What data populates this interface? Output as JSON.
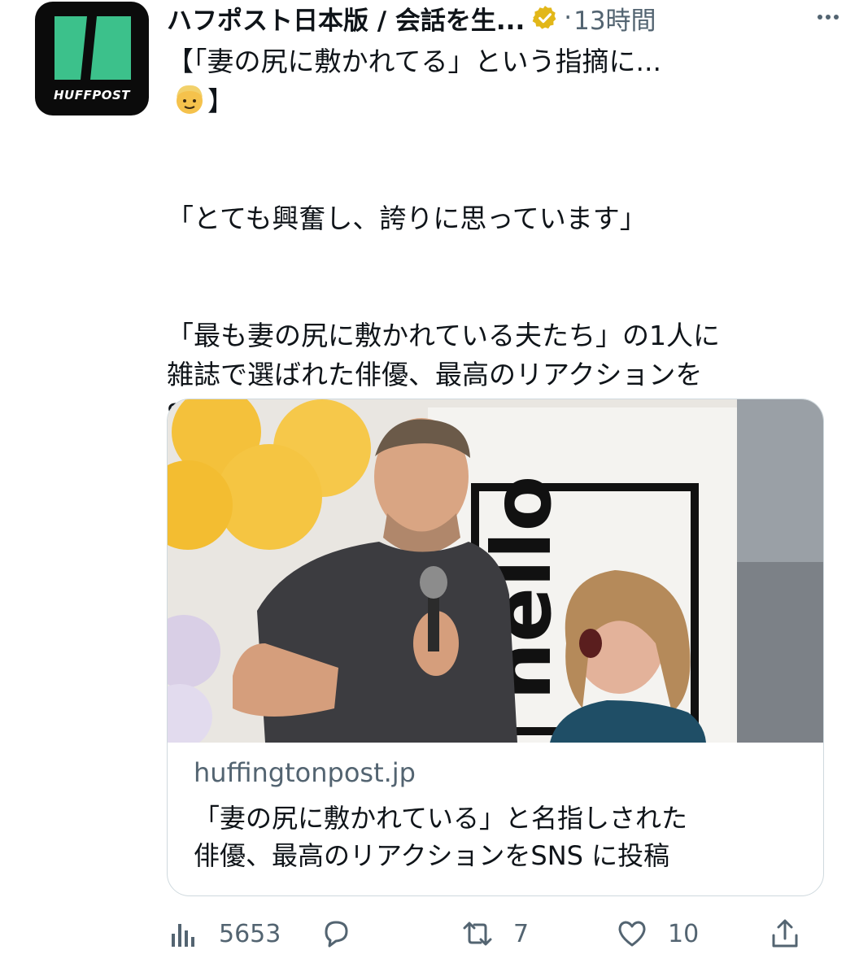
{
  "account": {
    "name": "ハフポスト日本版 / 会話を生...",
    "logo_text": "HUFFPOST",
    "verified_color": "#e2b719",
    "separator": "·",
    "timestamp": "13時間"
  },
  "tweet": {
    "text_line1": "【「妻の尻に敷かれてる」という指摘に...",
    "emoji": "man-emoji",
    "text_line2_suffix": "】",
    "paragraph1": "「とても興奮し、誇りに思っています」",
    "paragraph2": "「最も妻の尻に敷かれている夫たち」の1人に\n雑誌で選ばれた俳優、最高のリアクションを\nSNS に投稿。"
  },
  "card": {
    "domain": "huffingtonpost.jp",
    "title": "「妻の尻に敷かれている」と名指しされた\n俳優、最高のリアクションをSNS に投稿",
    "sign_text": "hello"
  },
  "actions": {
    "views": "5653",
    "retweets": "7",
    "likes": "10",
    "reply_icon": "reply-icon",
    "share_icon": "share-icon"
  },
  "colors": {
    "brand": "#3cc18b",
    "muted": "#536471",
    "text": "#0f1419"
  }
}
